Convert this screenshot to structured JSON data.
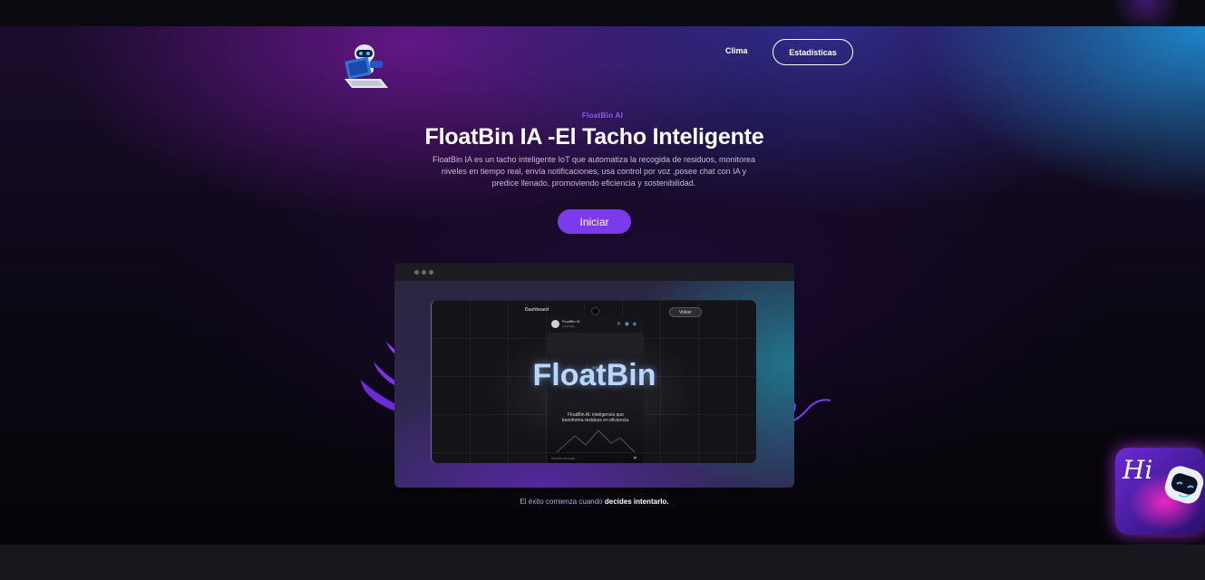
{
  "nav": {
    "logo": "robot-laptop-logo",
    "links": [
      {
        "label": "Clima"
      },
      {
        "label": "Estadísticas"
      }
    ]
  },
  "hero": {
    "eyebrow": "FloatBin AI",
    "title": "FloatBin IA -El Tacho Inteligente",
    "description": "FloatBin IA es un tacho inteligente IoT que automatiza la recogida de residuos, monitorea niveles en tiempo real, envía notificaciones, usa control por voz ,posee chat con IA y predice llenado, promoviendo eficiencia y sostenibilidad.",
    "cta": "Iniciar"
  },
  "preview": {
    "dashboard_label": "Dashboard",
    "back_button": "Volver",
    "app_name": "FloatBin IA",
    "app_status": "conectado",
    "small_label": "ARIA",
    "big_word": "FloatBin",
    "caption": "FloatBin AI: inteligencia que transforma residuos en eficiencia.",
    "input_placeholder": "Escribe mensaje..."
  },
  "footer_tagline": {
    "prefix": "El éxito comienza cuando",
    "emphasis": "decides intentarlo."
  },
  "mascot": {
    "greeting": "Hi"
  },
  "colors": {
    "accent": "#7c3aed",
    "eyebrow": "#8a5cf6",
    "cyan_glow": "#1e8cd2"
  }
}
